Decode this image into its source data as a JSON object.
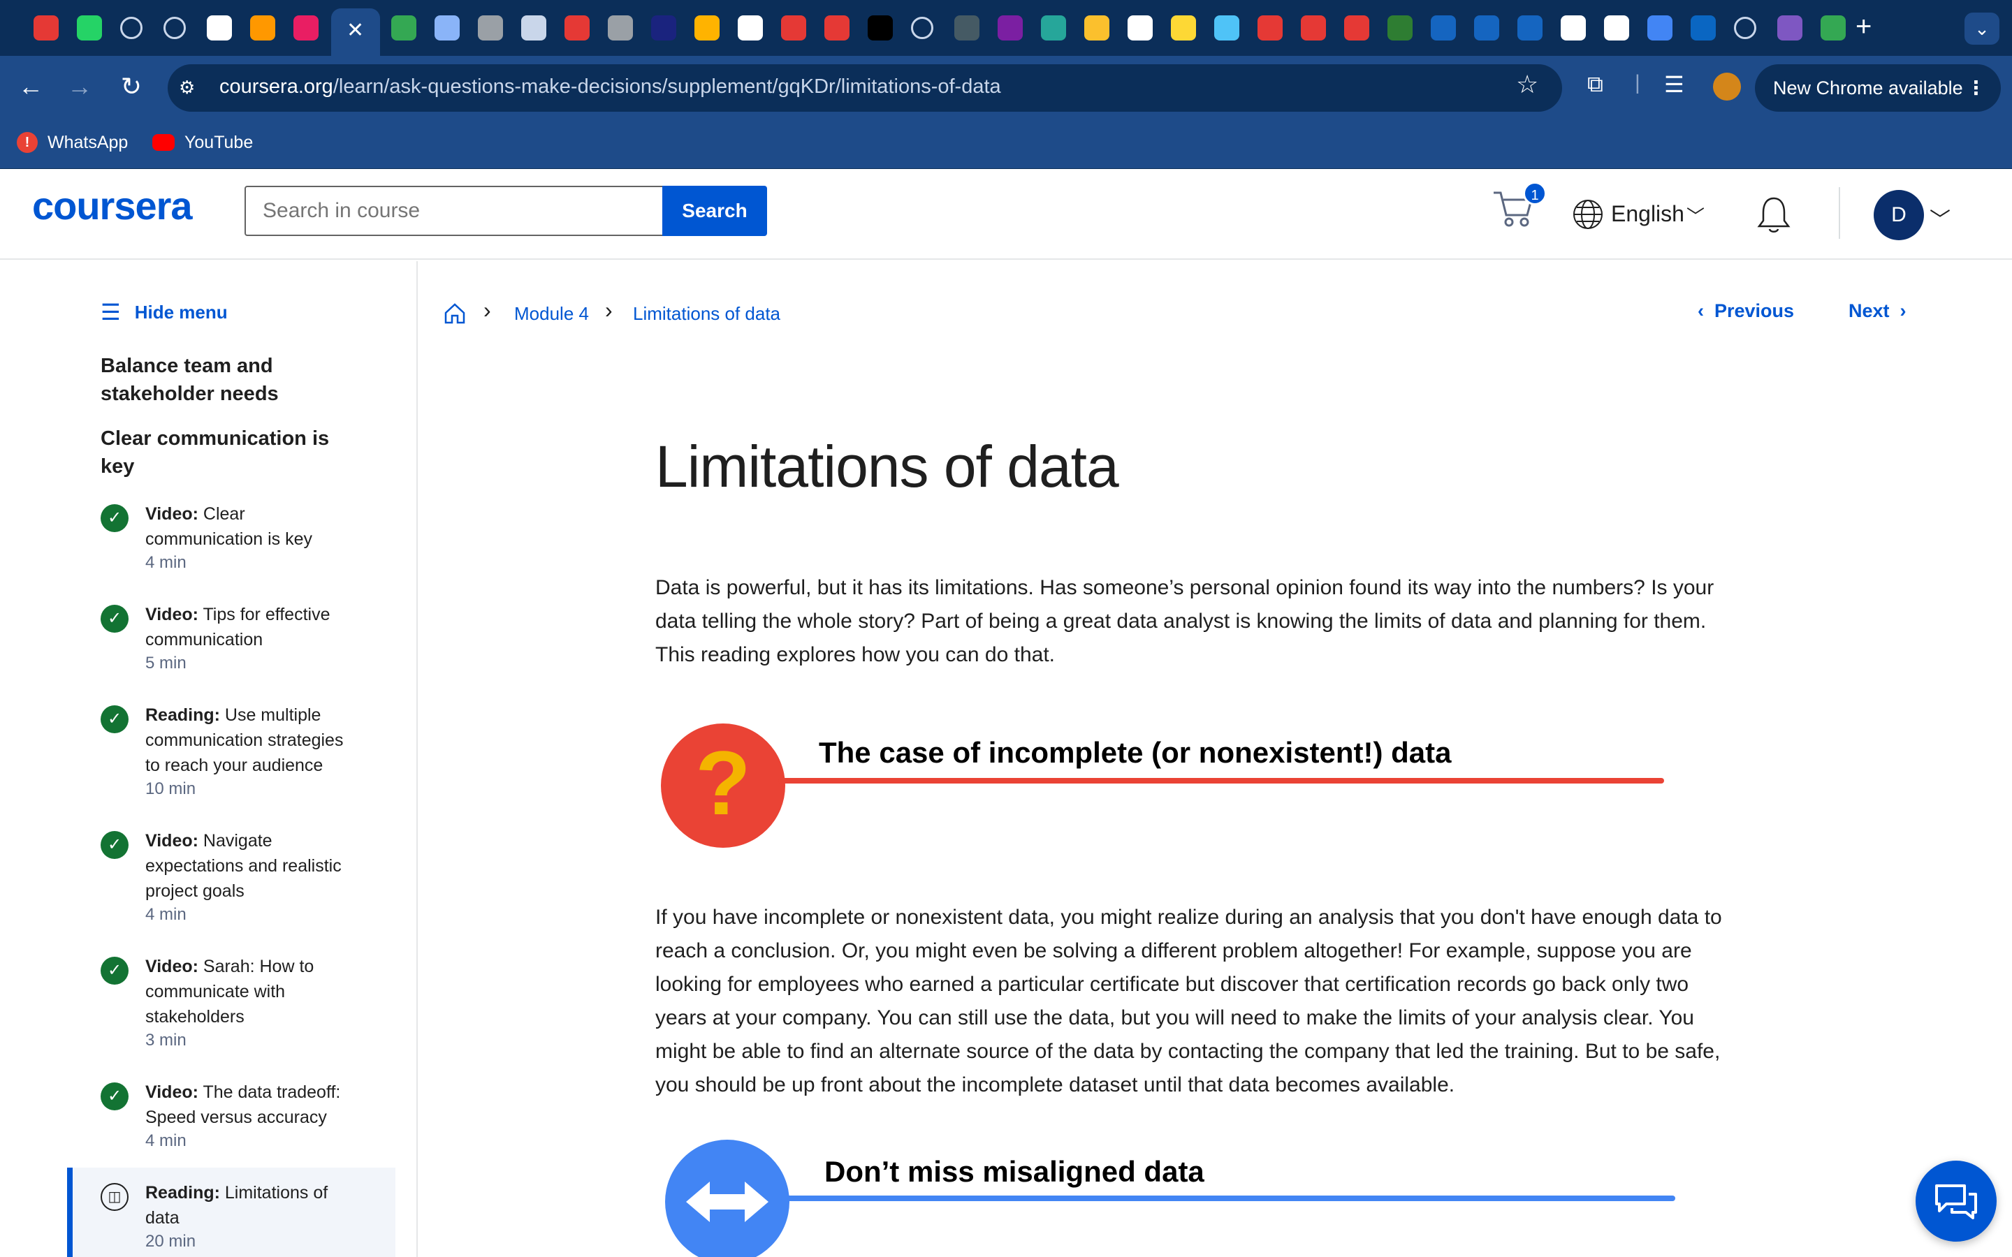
{
  "browser": {
    "url_domain": "coursera.org",
    "url_path": "/learn/ask-questions-make-decisions/supplement/gqKDr/limitations-of-data",
    "update_label": "New Chrome available",
    "bookmarks": [
      {
        "label": "WhatsApp"
      },
      {
        "label": "YouTube"
      }
    ],
    "tab_favicons": [
      "youtube-icon",
      "whatsapp-icon",
      "loading-icon",
      "loading-icon",
      "github-icon",
      "arrow-app-icon",
      "pink-app-icon",
      "close-tab-icon",
      "plus-app-icon",
      "k-app-icon",
      "globe-icon",
      "c-app-icon",
      "record-icon",
      "camera-icon",
      "n-app-icon",
      "m-app-icon",
      "audio-icon",
      "youtube-icon",
      "youtube-icon",
      "gt-icon",
      "loading-icon",
      "grid-icon",
      "video-icon",
      "circle-app-icon",
      "b-app-icon",
      "google-icon",
      "target-icon",
      "wave-icon",
      "red-ball-icon",
      "red-ball-icon",
      "youtube-icon",
      "unt-icon",
      "c-app-icon",
      "c-app-icon",
      "c-app-icon",
      "openai-icon",
      "openai-icon",
      "map-pin-icon",
      "linkedin-icon",
      "loading-icon",
      "w-app-icon",
      "chat-app-icon"
    ],
    "cart_count": "1",
    "bm_whatsapp_glyph": "!"
  },
  "header": {
    "logo": "coursera",
    "search_placeholder": "Search in course",
    "search_button": "Search",
    "language": "English",
    "avatar_initial": "D"
  },
  "sidebar": {
    "hide_menu": "Hide menu",
    "headings": [
      "Balance team and stakeholder needs",
      "Clear communication is key"
    ],
    "items": [
      {
        "type": "Video:",
        "title": " Clear communication is key",
        "time": "4 min"
      },
      {
        "type": "Video:",
        "title": " Tips for effective communication",
        "time": "5 min"
      },
      {
        "type": "Reading:",
        "title": " Use multiple communication strategies to reach your audience",
        "time": "10 min"
      },
      {
        "type": "Video:",
        "title": " Navigate expectations and realistic project goals",
        "time": "4 min"
      },
      {
        "type": "Video:",
        "title": " Sarah: How to communicate with stakeholders",
        "time": "3 min"
      },
      {
        "type": "Video:",
        "title": " The data tradeoff: Speed versus accuracy",
        "time": "4 min"
      },
      {
        "type": "Reading:",
        "title": " Limitations of data",
        "time": "20 min"
      }
    ]
  },
  "main": {
    "breadcrumb": [
      "Module 4",
      "Limitations of data"
    ],
    "prev": "Previous",
    "next": "Next",
    "title": "Limitations of data",
    "intro": "Data is powerful, but it has its limitations. Has someone’s personal opinion found its way into the numbers? Is your data telling the whole story? Part of being a great data analyst is knowing the limits of data and planning for them. This reading explores how you can do that.",
    "section1": {
      "heading": "The case of incomplete (or nonexistent!) data",
      "body": "If you have incomplete or nonexistent data, you might realize during an analysis that you don't have enough data to reach a conclusion. Or, you might even be solving a different problem altogether! For example, suppose you are looking for employees who earned a particular certificate but discover that certification records go back only two years at your company. You can still use the data, but you will need to make the limits of your analysis clear. You might be able to find an alternate source of the data by contacting the company that led the training. But to be safe, you should be up front about the incomplete dataset until that data becomes available."
    },
    "section2": {
      "heading": "Don’t miss misaligned data"
    }
  },
  "colors": {
    "brand": "#0056d2",
    "chrome_dark": "#0b2e59",
    "chrome_mid": "#1e4b89",
    "complete": "#137333",
    "section1_accent": "#ea4335",
    "section2_accent": "#4285f4"
  }
}
